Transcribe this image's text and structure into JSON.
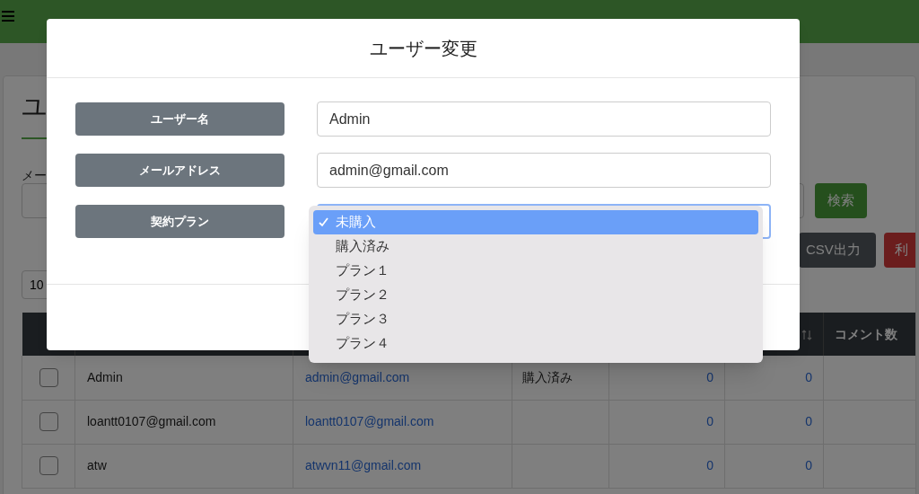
{
  "page": {
    "title": "ユ",
    "filter_label": "メー",
    "search_button": "検索",
    "csv_button": "CSV出力",
    "usage_button": "利",
    "page_size": "10"
  },
  "table": {
    "columns": [
      "コメント数"
    ],
    "rows": [
      {
        "checked": false,
        "name": "Admin",
        "email": "admin@gmail.com",
        "plan": "購入済み",
        "column_5": "0",
        "column_6": "0"
      },
      {
        "checked": false,
        "name": "loantt0107@gmail.com",
        "email": "loantt0107@gmail.com",
        "plan": "",
        "column_5": "0",
        "column_6": "0"
      },
      {
        "checked": false,
        "name": "atw",
        "email": "atwvn11@gmail.com",
        "plan": "",
        "column_5": "0",
        "column_6": "0"
      }
    ]
  },
  "modal": {
    "title": "ユーザー変更",
    "fields": [
      {
        "label": "ユーザー名",
        "kind": "text",
        "value": "Admin"
      },
      {
        "label": "メールアドレス",
        "kind": "text",
        "value": "admin@gmail.com"
      },
      {
        "label": "契約プラン",
        "kind": "select"
      }
    ]
  },
  "dropdown": {
    "options": [
      {
        "label": "未購入",
        "selected": true
      },
      {
        "label": "購入済み",
        "selected": false
      },
      {
        "label": "プラン１",
        "selected": false
      },
      {
        "label": "プラン２",
        "selected": false
      },
      {
        "label": "プラン３",
        "selected": false
      },
      {
        "label": "プラン４",
        "selected": false
      }
    ]
  }
}
